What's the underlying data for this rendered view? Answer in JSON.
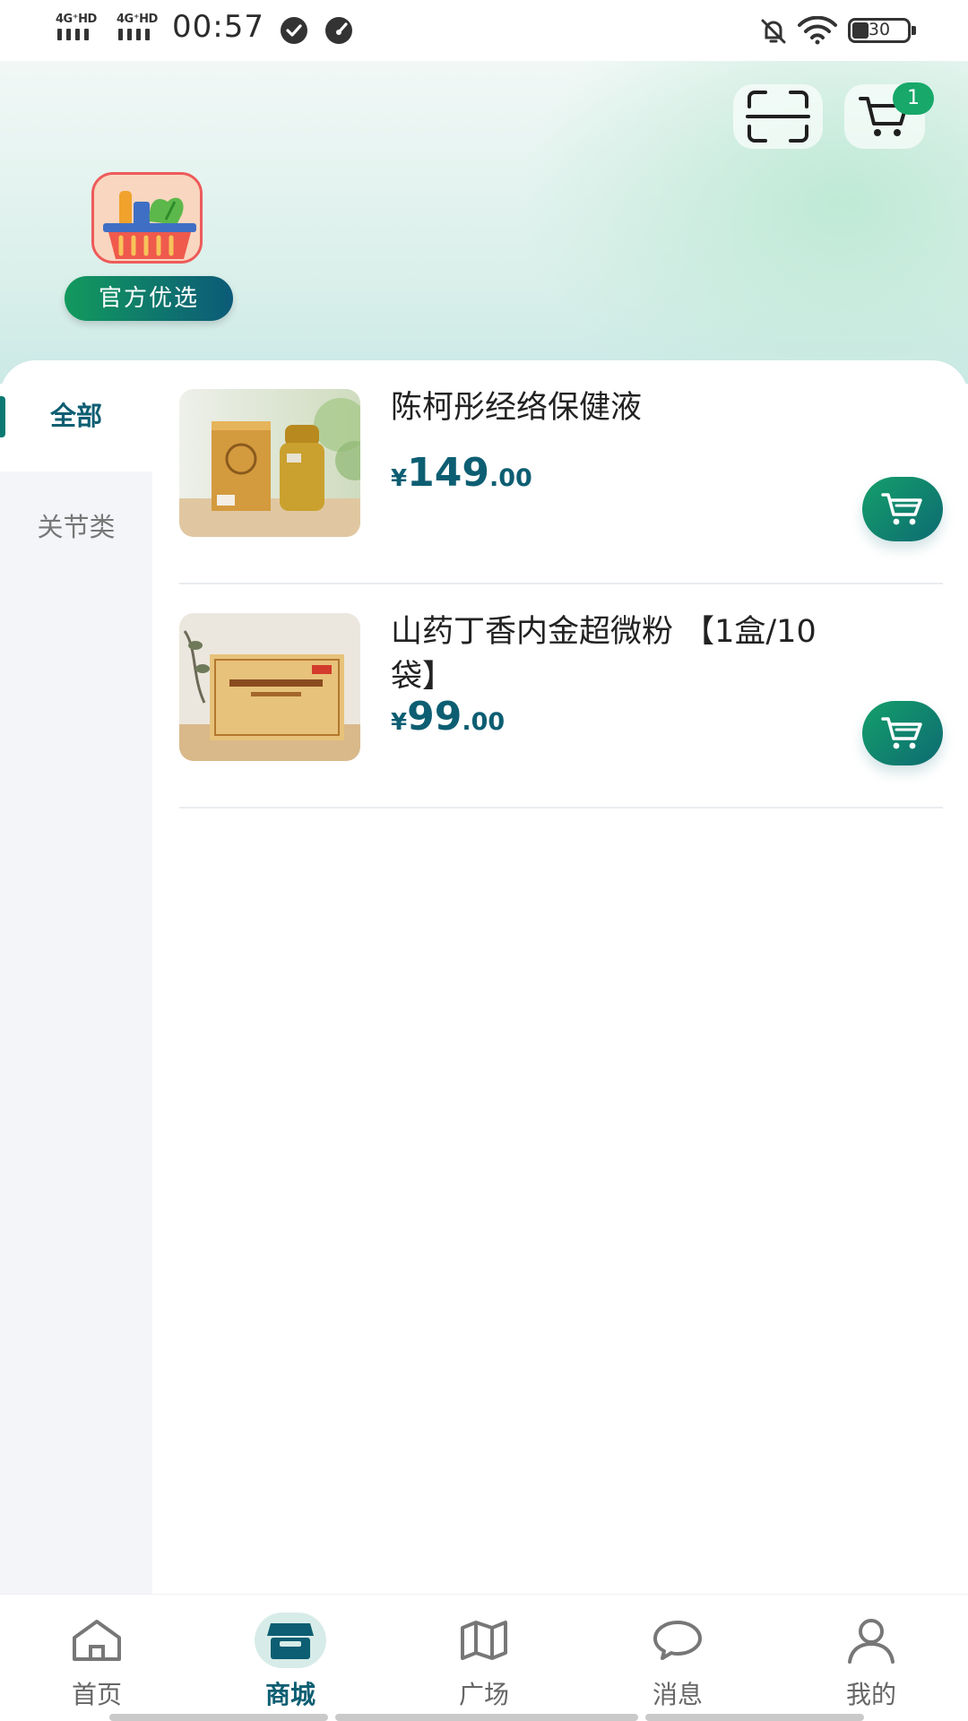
{
  "status_bar": {
    "network_1": "4G⁺HD",
    "network_2": "4G⁺HD",
    "time": "00:57",
    "battery": "30"
  },
  "header": {
    "cart_count": "1",
    "shop_label": "官方优选"
  },
  "categories": [
    {
      "label": "全部",
      "active": true
    },
    {
      "label": "关节类",
      "active": false
    }
  ],
  "products": [
    {
      "name": "陈柯彤经络保健液",
      "currency": "¥",
      "price_int": "149",
      "price_dec": ".00"
    },
    {
      "name": "山药丁香内金超微粉 【1盒/10袋】",
      "currency": "¥",
      "price_int": "99",
      "price_dec": ".00"
    }
  ],
  "tabs": [
    {
      "label": "首页",
      "icon": "home-icon"
    },
    {
      "label": "商城",
      "icon": "store-icon",
      "active": true
    },
    {
      "label": "广场",
      "icon": "map-icon"
    },
    {
      "label": "消息",
      "icon": "chat-icon"
    },
    {
      "label": "我的",
      "icon": "user-icon"
    }
  ],
  "colors": {
    "accent": "#0d5e72",
    "green": "#17a86a"
  }
}
